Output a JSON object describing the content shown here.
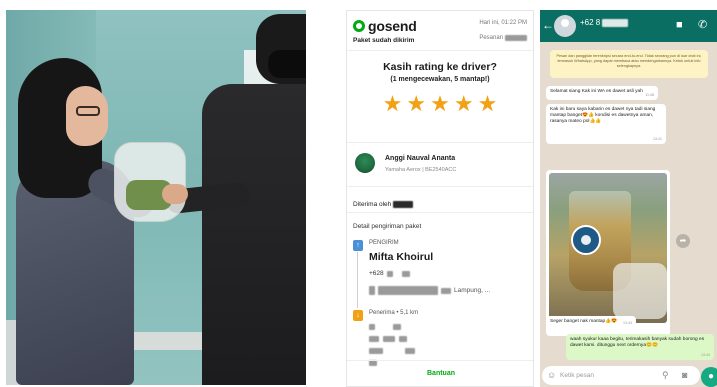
{
  "gosend": {
    "logo": "gosend",
    "status": "Paket sudah dikirim",
    "date": "Hari ini, 01:22 PM",
    "order_label": "Pesanan",
    "rating_question": "Kasih rating ke driver?",
    "rating_sub": "(1 mengecewakan, 5 mantap!)",
    "stars": 5,
    "star_color": "#f0a114",
    "driver_name": "Anggi Nauval Ananta",
    "vehicle": "Yamaha Aerox | BE2540ACC",
    "receiver_label": "Diterima oleh",
    "detail_title": "Detail pengiriman paket",
    "sender_label": "PENGIRIM",
    "sender_name": "Mifta Khoirul",
    "sender_phone": "+628",
    "sender_address_tail": "Lampung, ...",
    "receiver_route_label": "Penerima • 5,1 km",
    "help_label": "Bantuan",
    "brand_color": "#00aa13"
  },
  "whatsapp": {
    "contact": "+62 8",
    "notice": "Pesan dan panggilan terenkripsi secara end-to-end. Tidak seorang pun di luar chat ini, termasuk WhatsApp, yang dapat membaca atau mendengarkannya. Ketuk untuk info selengkapnya.",
    "messages": [
      {
        "text": "Selamat siang Kak ini WA es dawet asli yah",
        "time": "11:48"
      },
      {
        "text": "Kak ini baru saya kabarin es dawet nya tadi siang mantap banget😍👍 kondisi es dawetnya aman, rasanya mateo pol👍👍",
        "time": "13:41"
      },
      {
        "text": "Seger banget nak mantap👍😍",
        "time": "13:43"
      },
      {
        "text": "waah syukur kaaa begitu, terimakasih banyak sudah borong es dawet kami. ditunggu next ordernya😊😊",
        "time": "13:44"
      }
    ],
    "placeholder": "Ketik pesan",
    "header_color": "#0b6e63",
    "mic_color": "#17a884"
  }
}
